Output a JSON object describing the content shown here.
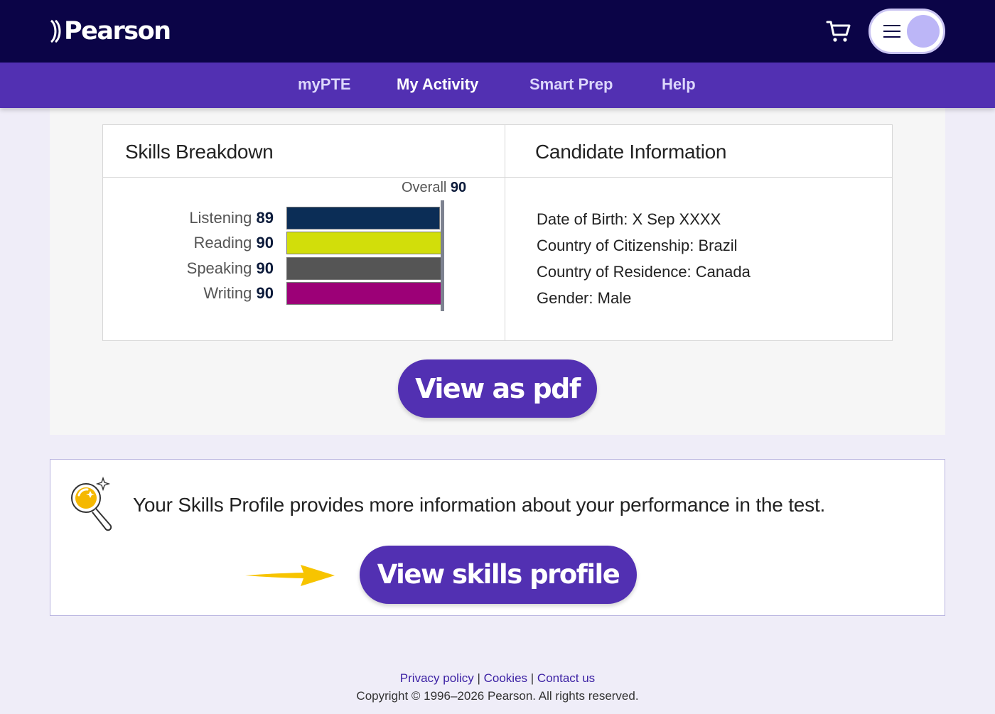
{
  "brand": {
    "name": "Pearson"
  },
  "nav": {
    "items": [
      {
        "label": "myPTE"
      },
      {
        "label": "My Activity"
      },
      {
        "label": "Smart Prep"
      },
      {
        "label": "Help"
      }
    ]
  },
  "skills": {
    "title": "Skills Breakdown",
    "overall_label": "Overall",
    "overall_value": "90",
    "items": [
      {
        "label": "Listening",
        "score": "89",
        "score_value": 89,
        "color": "#0b2d56"
      },
      {
        "label": "Reading",
        "score": "90",
        "score_value": 90,
        "color": "#d2de0a"
      },
      {
        "label": "Speaking",
        "score": "90",
        "score_value": 90,
        "color": "#555555"
      },
      {
        "label": "Writing",
        "score": "90",
        "score_value": 90,
        "color": "#9c0077"
      }
    ],
    "scale_max": 90
  },
  "candidate": {
    "title": "Candidate Information",
    "dob_label": "Date of Birth:",
    "dob_value": "X Sep XXXX",
    "citizenship_label": "Country of Citizenship:",
    "citizenship_value": "Brazil",
    "residence_label": "Country of Residence:",
    "residence_value": "Canada",
    "gender_label": "Gender:",
    "gender_value": "Male"
  },
  "actions": {
    "pdf_label": "View as pdf",
    "skills_profile_label": "View skills profile"
  },
  "skills_profile": {
    "text": "Your Skills Profile provides more information about your performance in the test."
  },
  "footer": {
    "privacy": "Privacy policy",
    "cookies": "Cookies",
    "contact": "Contact us",
    "separator": "|",
    "copyright": "Copyright © 1996–2026 Pearson. All rights reserved."
  },
  "colors": {
    "header_bg": "#0b0447",
    "nav_bg": "#5230b2",
    "button_bg": "#5230b2",
    "page_bg": "#efedf8"
  }
}
